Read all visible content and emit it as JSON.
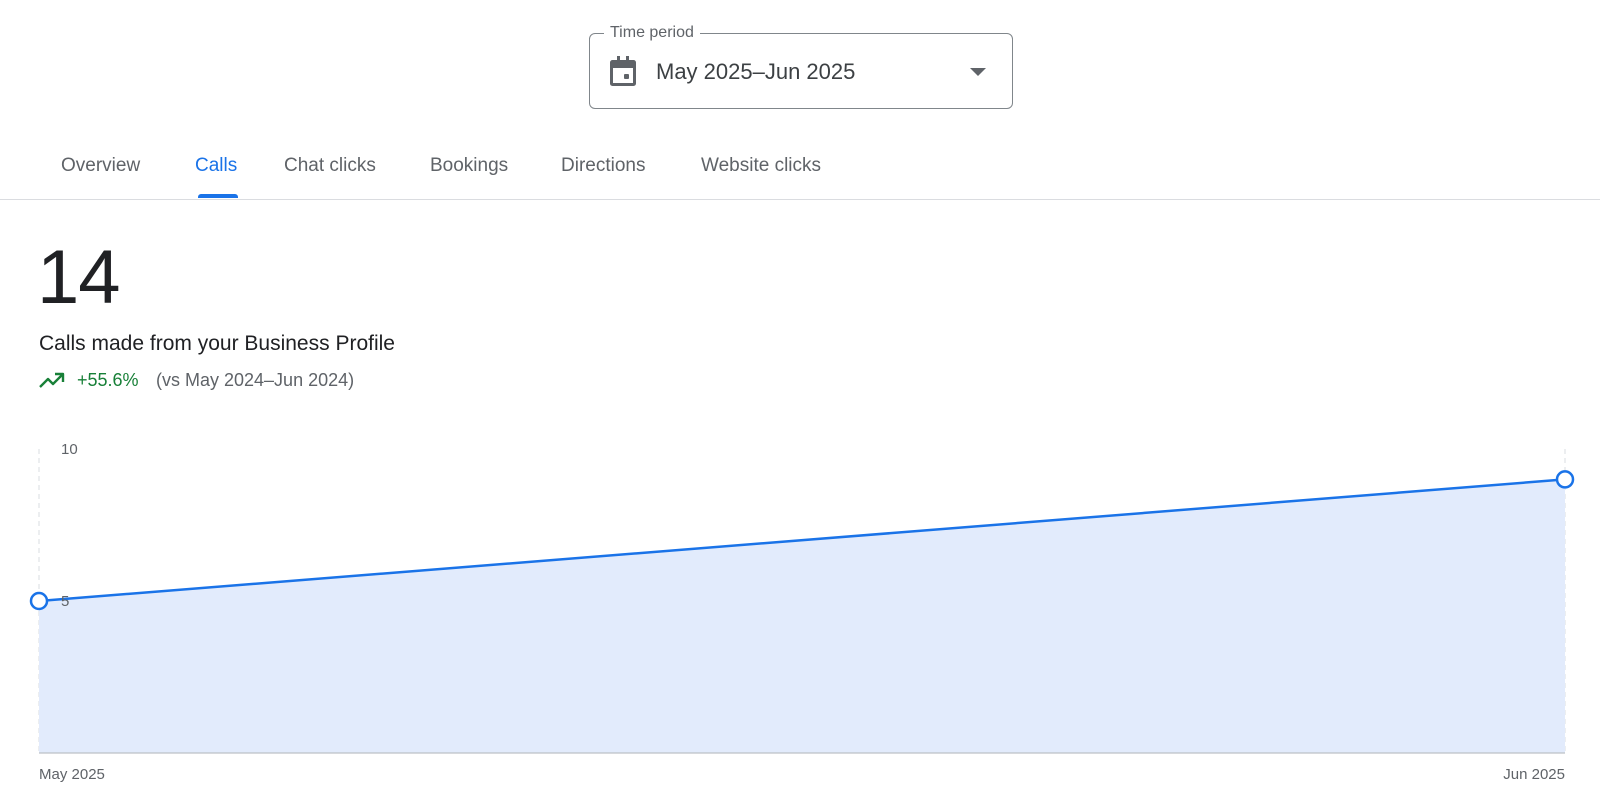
{
  "time_period": {
    "label": "Time period",
    "value": "May 2025–Jun 2025"
  },
  "tabs": [
    {
      "label": "Overview",
      "active": false
    },
    {
      "label": "Calls",
      "active": true
    },
    {
      "label": "Chat clicks",
      "active": false
    },
    {
      "label": "Bookings",
      "active": false
    },
    {
      "label": "Directions",
      "active": false
    },
    {
      "label": "Website clicks",
      "active": false
    }
  ],
  "metric": {
    "value": "14",
    "label": "Calls made from your Business Profile",
    "change": "+55.6%",
    "comparison": "(vs May 2024–Jun 2024)",
    "trend_icon": "trending-up-icon"
  },
  "colors": {
    "accent": "#1a73e8",
    "positive": "#188038",
    "area_fill": "#e2ebfc"
  },
  "chart_data": {
    "type": "area",
    "x": [
      "May 2025",
      "Jun 2025"
    ],
    "series": [
      {
        "values": [
          5,
          9
        ]
      }
    ],
    "ylim": [
      0,
      10
    ],
    "y_ticks": [
      "5",
      "10"
    ],
    "x_ticks": [
      "May 2025",
      "Jun 2025"
    ],
    "grid": false
  }
}
